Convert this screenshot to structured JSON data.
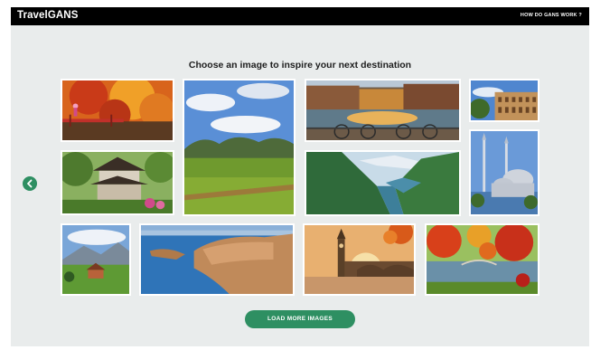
{
  "header": {
    "brand": "TravelGANS",
    "nav_link": "HOW DO GANS WORK ?"
  },
  "main": {
    "heading": "Choose an image to inspire your next destination",
    "load_more_label": "LOAD MORE IMAGES",
    "prev_icon": "chevron-left-icon"
  },
  "colors": {
    "accent": "#2e8f62",
    "topbar": "#000000",
    "background": "#e9ecec"
  },
  "gallery": [
    "autumn-japanese-garden",
    "valley-landscape",
    "canal-bicycles",
    "colosseum",
    "japanese-pagoda-house",
    "fjord",
    "mosque",
    "alpine-meadow",
    "coastal-city",
    "big-ben-london",
    "autumn-lake-park"
  ]
}
